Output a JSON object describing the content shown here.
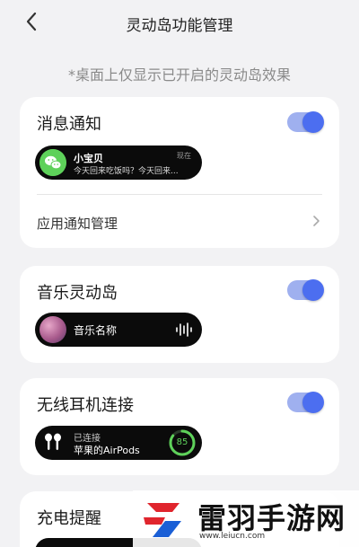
{
  "header": {
    "title": "灵动岛功能管理",
    "back_icon": "chevron-left-icon"
  },
  "note": "*桌面上仅显示已开启的灵动岛效果",
  "accent": "#4c6ef0",
  "cards": {
    "message": {
      "title": "消息通知",
      "enabled": true,
      "preview": {
        "sender": "小宝贝",
        "time": "现在",
        "text": "今天回来吃饭吗？今天回来..."
      },
      "manage_label": "应用通知管理"
    },
    "music": {
      "title": "音乐灵动岛",
      "enabled": true,
      "preview": {
        "song": "音乐名称"
      }
    },
    "earphone": {
      "title": "无线耳机连接",
      "enabled": true,
      "preview": {
        "status": "已连接",
        "device": "苹果的AirPods",
        "battery": 85
      }
    },
    "charging": {
      "title": "充电提醒"
    }
  },
  "watermark": {
    "text": "雷羽手游网",
    "url": "www.leiucn.com"
  }
}
